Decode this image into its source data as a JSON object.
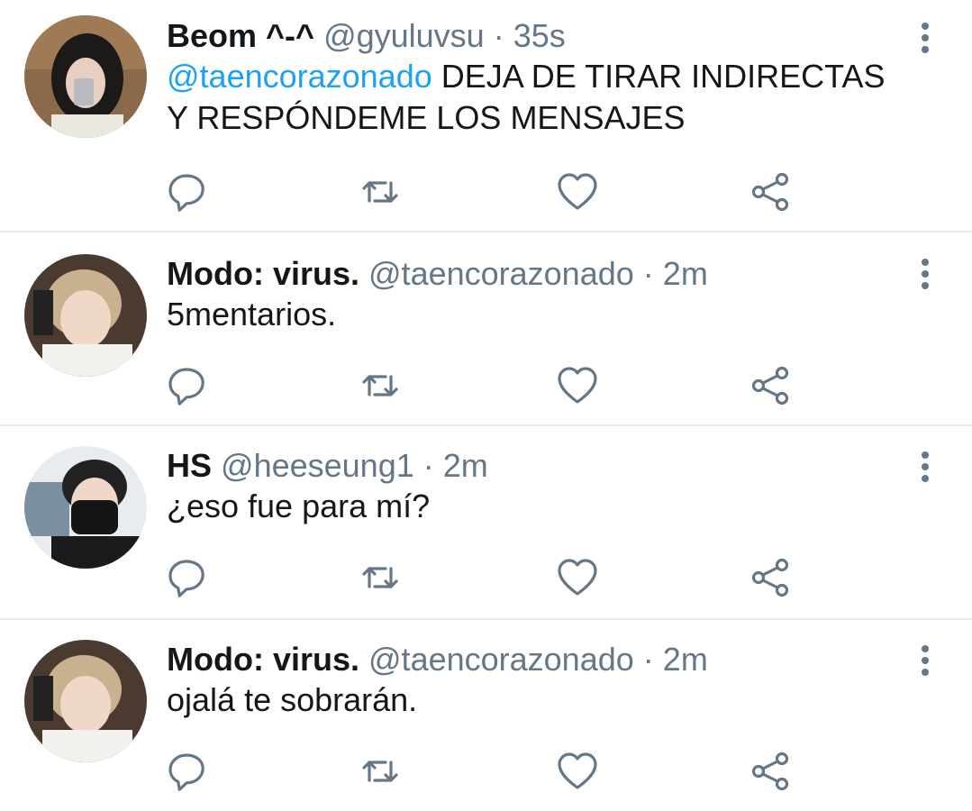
{
  "colors": {
    "text": "#14171a",
    "secondary": "#657786",
    "link": "#1da1f2",
    "icon": "#657786",
    "divider": "#e6ecf0"
  },
  "tweets": [
    {
      "name": "Beom ^-^",
      "handle": "@gyuluvsu",
      "separator": "·",
      "time": "35s",
      "mention": "@taencorazonado",
      "text": " DEJA DE TIRAR INDIRECTAS Y RESPÓNDEME LOS MENSAJES"
    },
    {
      "name": "Modo: virus.",
      "handle": "@taencorazonado",
      "separator": "·",
      "time": "2m",
      "mention": "",
      "text": "5mentarios."
    },
    {
      "name": "HS",
      "handle": "@heeseung1",
      "separator": "·",
      "time": "2m",
      "mention": "",
      "text": "¿eso fue para mí?"
    },
    {
      "name": "Modo: virus.",
      "handle": "@taencorazonado",
      "separator": "·",
      "time": "2m",
      "mention": "",
      "text": "ojalá te sobrarán."
    }
  ],
  "icons": {
    "reply": "reply-icon",
    "retweet": "retweet-icon",
    "like": "heart-icon",
    "share": "share-icon",
    "more": "more-vertical-icon"
  }
}
